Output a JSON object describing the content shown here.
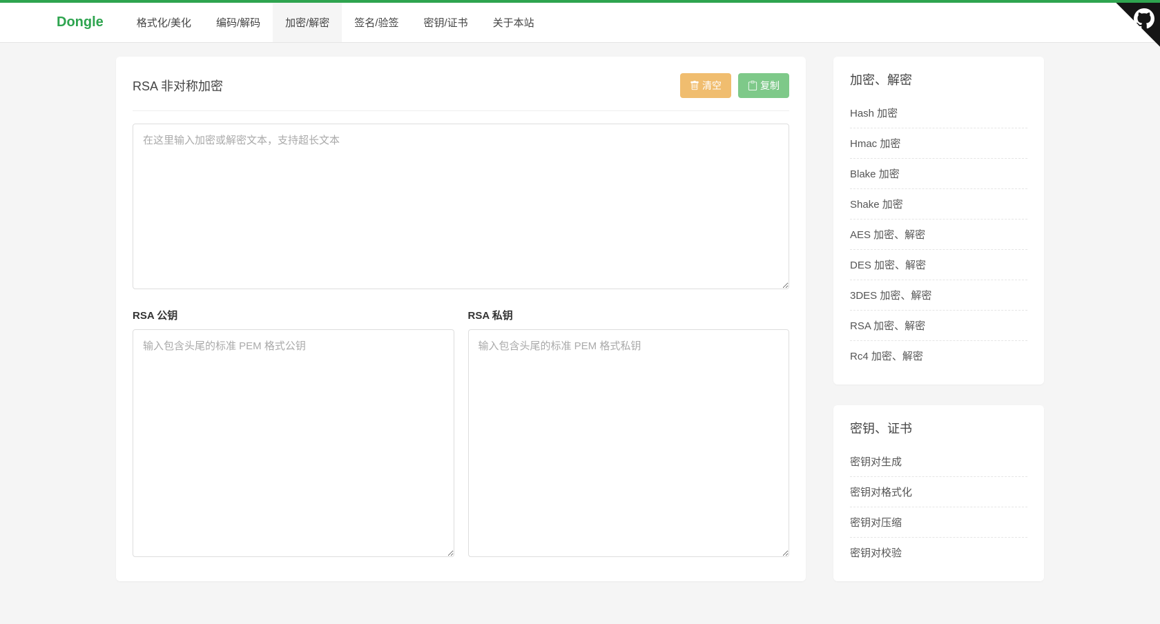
{
  "brand": "Dongle",
  "nav": [
    {
      "label": "格式化/美化",
      "active": false
    },
    {
      "label": "编码/解码",
      "active": false
    },
    {
      "label": "加密/解密",
      "active": true
    },
    {
      "label": "签名/验签",
      "active": false
    },
    {
      "label": "密钥/证书",
      "active": false
    },
    {
      "label": "关于本站",
      "active": false
    }
  ],
  "main": {
    "title": "RSA 非对称加密",
    "clear_label": "清空",
    "copy_label": "复制",
    "input_placeholder": "在这里输入加密或解密文本，支持超长文本",
    "public_key_label": "RSA 公钥",
    "public_key_placeholder": "输入包含头尾的标准 PEM 格式公钥",
    "private_key_label": "RSA 私钥",
    "private_key_placeholder": "输入包含头尾的标准 PEM 格式私钥"
  },
  "sidebar": {
    "section1_title": "加密、解密",
    "section1_items": [
      "Hash 加密",
      "Hmac 加密",
      "Blake 加密",
      "Shake 加密",
      "AES 加密、解密",
      "DES 加密、解密",
      "3DES 加密、解密",
      "RSA 加密、解密",
      "Rc4 加密、解密"
    ],
    "section2_title": "密钥、证书",
    "section2_items": [
      "密钥对生成",
      "密钥对格式化",
      "密钥对压缩",
      "密钥对校验"
    ]
  }
}
